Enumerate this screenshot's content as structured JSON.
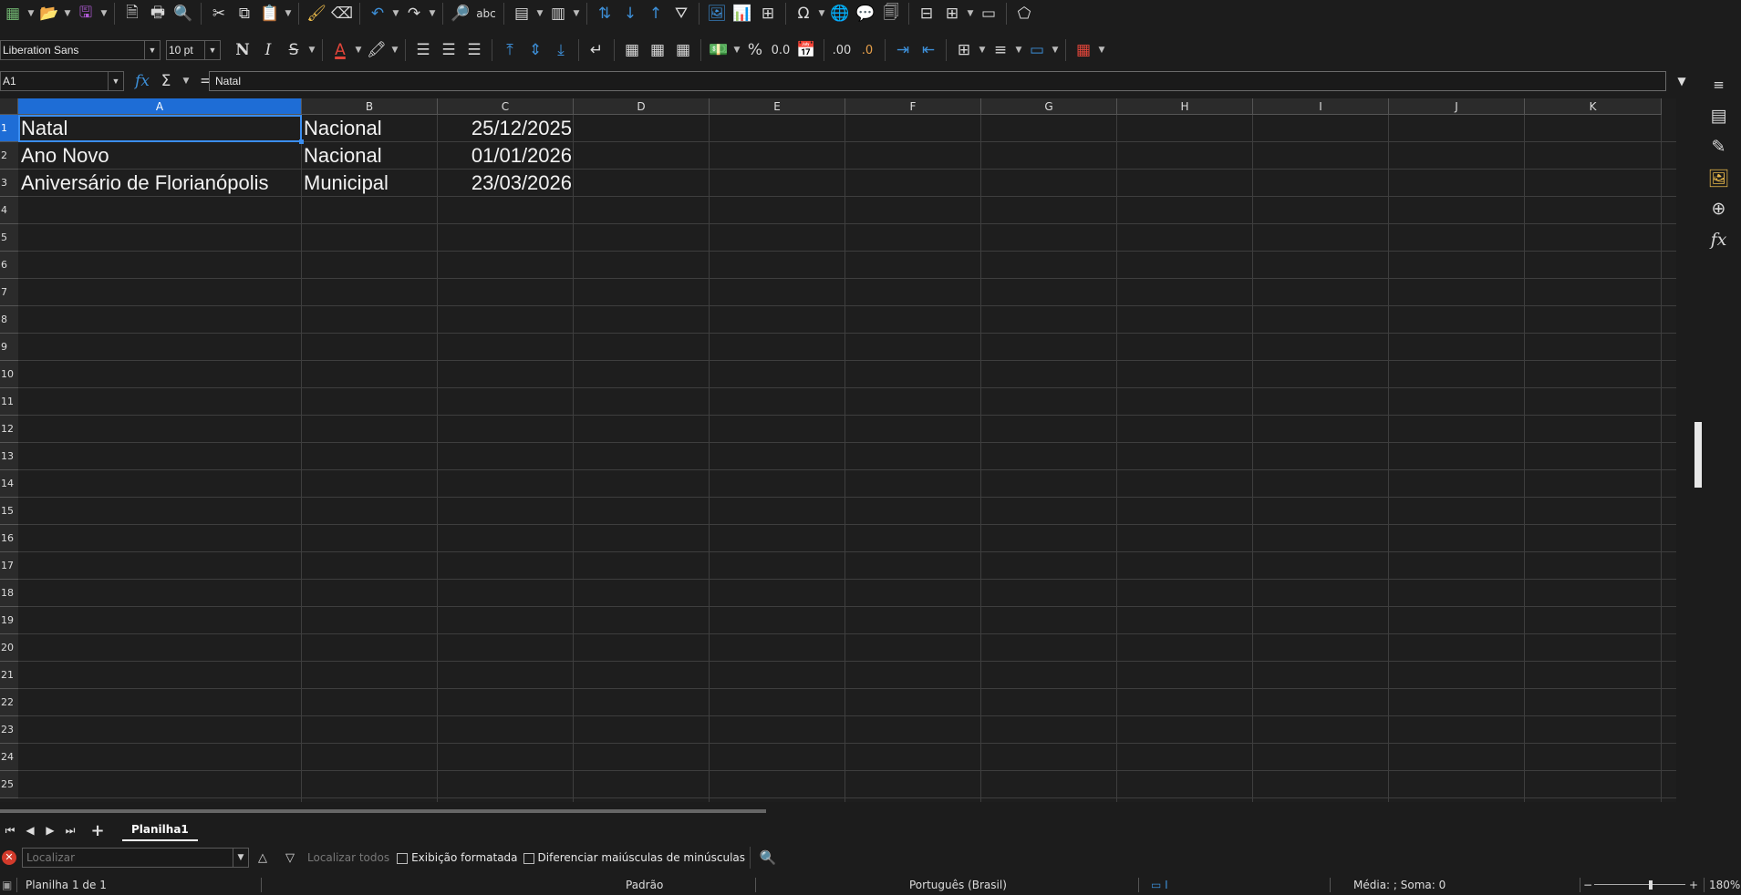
{
  "toolbar": {
    "font_name": "Liberation Sans",
    "font_size": "10 pt",
    "bold_label": "N",
    "italic_label": "I",
    "strike_label": "S",
    "font_color_label": "A",
    "percent_label": "%",
    "number_label": "0.0",
    "dec_add_label": ".00",
    "dec_remove_label": ".0"
  },
  "formula_bar": {
    "cell_ref": "A1",
    "fx_label": "fx",
    "sum_label": "Σ",
    "equals_label": "=",
    "content": "Natal"
  },
  "columns": [
    "A",
    "B",
    "C",
    "D",
    "E",
    "F",
    "G",
    "H",
    "I",
    "J",
    "K"
  ],
  "rows": [
    "1",
    "2",
    "3",
    "4",
    "5",
    "6",
    "7",
    "8",
    "9",
    "10",
    "11",
    "12",
    "13",
    "14",
    "15",
    "16",
    "17",
    "18",
    "19",
    "20",
    "21",
    "22",
    "23",
    "24",
    "25"
  ],
  "cells": [
    {
      "a": "Natal",
      "b": "Nacional",
      "c": "25/12/2025"
    },
    {
      "a": "Ano Novo",
      "b": "Nacional",
      "c": "01/01/2026"
    },
    {
      "a": "Aniversário de Florianópolis",
      "b": "Municipal",
      "c": "23/03/2026"
    }
  ],
  "sheet_tab": "Planilha1",
  "find": {
    "placeholder": "Localizar",
    "find_all": "Localizar todos",
    "formatted_display": "Exibição formatada",
    "match_case": "Diferenciar maiúsculas de minúsculas"
  },
  "status": {
    "sheet": "Planilha 1 de 1",
    "style": "Padrão",
    "language": "Português (Brasil)",
    "summary": "Média: ; Soma: 0",
    "zoom": "180%"
  },
  "accent_color": "#1e6dd6"
}
